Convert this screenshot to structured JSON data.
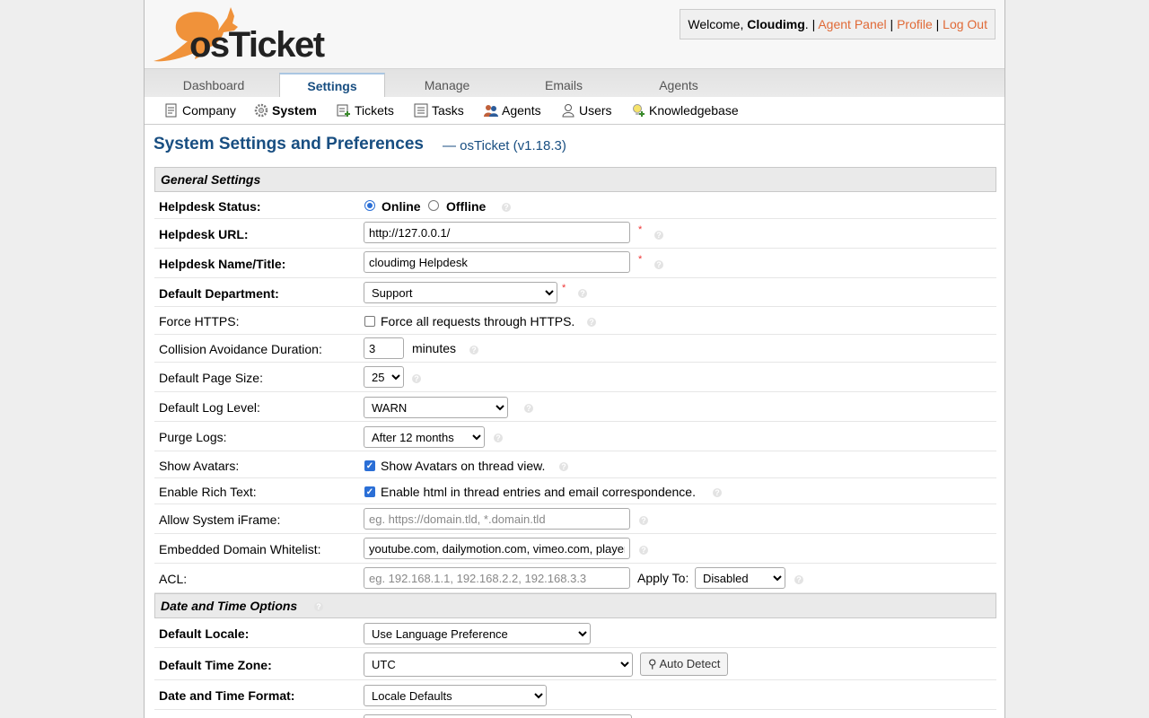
{
  "header": {
    "logo_text": "osTicket",
    "welcome_prefix": "Welcome, ",
    "username": "Cloudimg",
    "welcome_suffix": ". | ",
    "agent_panel": "Agent Panel",
    "sep": " | ",
    "profile": "Profile",
    "logout": "Log Out"
  },
  "nav": {
    "tabs": [
      "Dashboard",
      "Settings",
      "Manage",
      "Emails",
      "Agents"
    ],
    "active": "Settings"
  },
  "subnav": {
    "items": [
      "Company",
      "System",
      "Tickets",
      "Tasks",
      "Agents",
      "Users",
      "Knowledgebase"
    ],
    "active": "System"
  },
  "page": {
    "title": "System Settings and Preferences",
    "subtitle": "— osTicket (v1.18.3)"
  },
  "sections": {
    "general": "General Settings",
    "datetime": "Date and Time Options"
  },
  "fields": {
    "helpdesk_status": {
      "label": "Helpdesk Status:",
      "online": "Online",
      "offline": "Offline",
      "value": "Online"
    },
    "helpdesk_url": {
      "label": "Helpdesk URL:",
      "value": "http://127.0.0.1/"
    },
    "helpdesk_name": {
      "label": "Helpdesk Name/Title:",
      "value": "cloudimg Helpdesk"
    },
    "default_dept": {
      "label": "Default Department:",
      "value": "Support"
    },
    "force_https": {
      "label": "Force HTTPS:",
      "text": "Force all requests through HTTPS.",
      "checked": false
    },
    "collision": {
      "label": "Collision Avoidance Duration:",
      "value": "3",
      "unit": "minutes"
    },
    "page_size": {
      "label": "Default Page Size:",
      "value": "25"
    },
    "log_level": {
      "label": "Default Log Level:",
      "value": "WARN"
    },
    "purge_logs": {
      "label": "Purge Logs:",
      "value": "After 12 months"
    },
    "avatars": {
      "label": "Show Avatars:",
      "text": "Show Avatars on thread view.",
      "checked": true
    },
    "rich_text": {
      "label": "Enable Rich Text:",
      "text": "Enable html in thread entries and email correspondence.",
      "checked": true
    },
    "iframe": {
      "label": "Allow System iFrame:",
      "placeholder": "eg. https://domain.tld, *.domain.tld"
    },
    "whitelist": {
      "label": "Embedded Domain Whitelist:",
      "value": "youtube.com, dailymotion.com, vimeo.com, player.vimeo.com"
    },
    "acl": {
      "label": "ACL:",
      "placeholder": "eg. 192.168.1.1, 192.168.2.2, 192.168.3.3",
      "apply_label": "Apply To:",
      "apply_value": "Disabled"
    },
    "locale": {
      "label": "Default Locale:",
      "value": "Use Language Preference"
    },
    "timezone": {
      "label": "Default Time Zone:",
      "value": "UTC",
      "auto_detect": "Auto Detect"
    },
    "datetime_format": {
      "label": "Date and Time Format:",
      "value": "Locale Defaults"
    }
  },
  "colors": {
    "accent": "#184e81",
    "link": "#e06a37",
    "required": "#ee3333"
  }
}
